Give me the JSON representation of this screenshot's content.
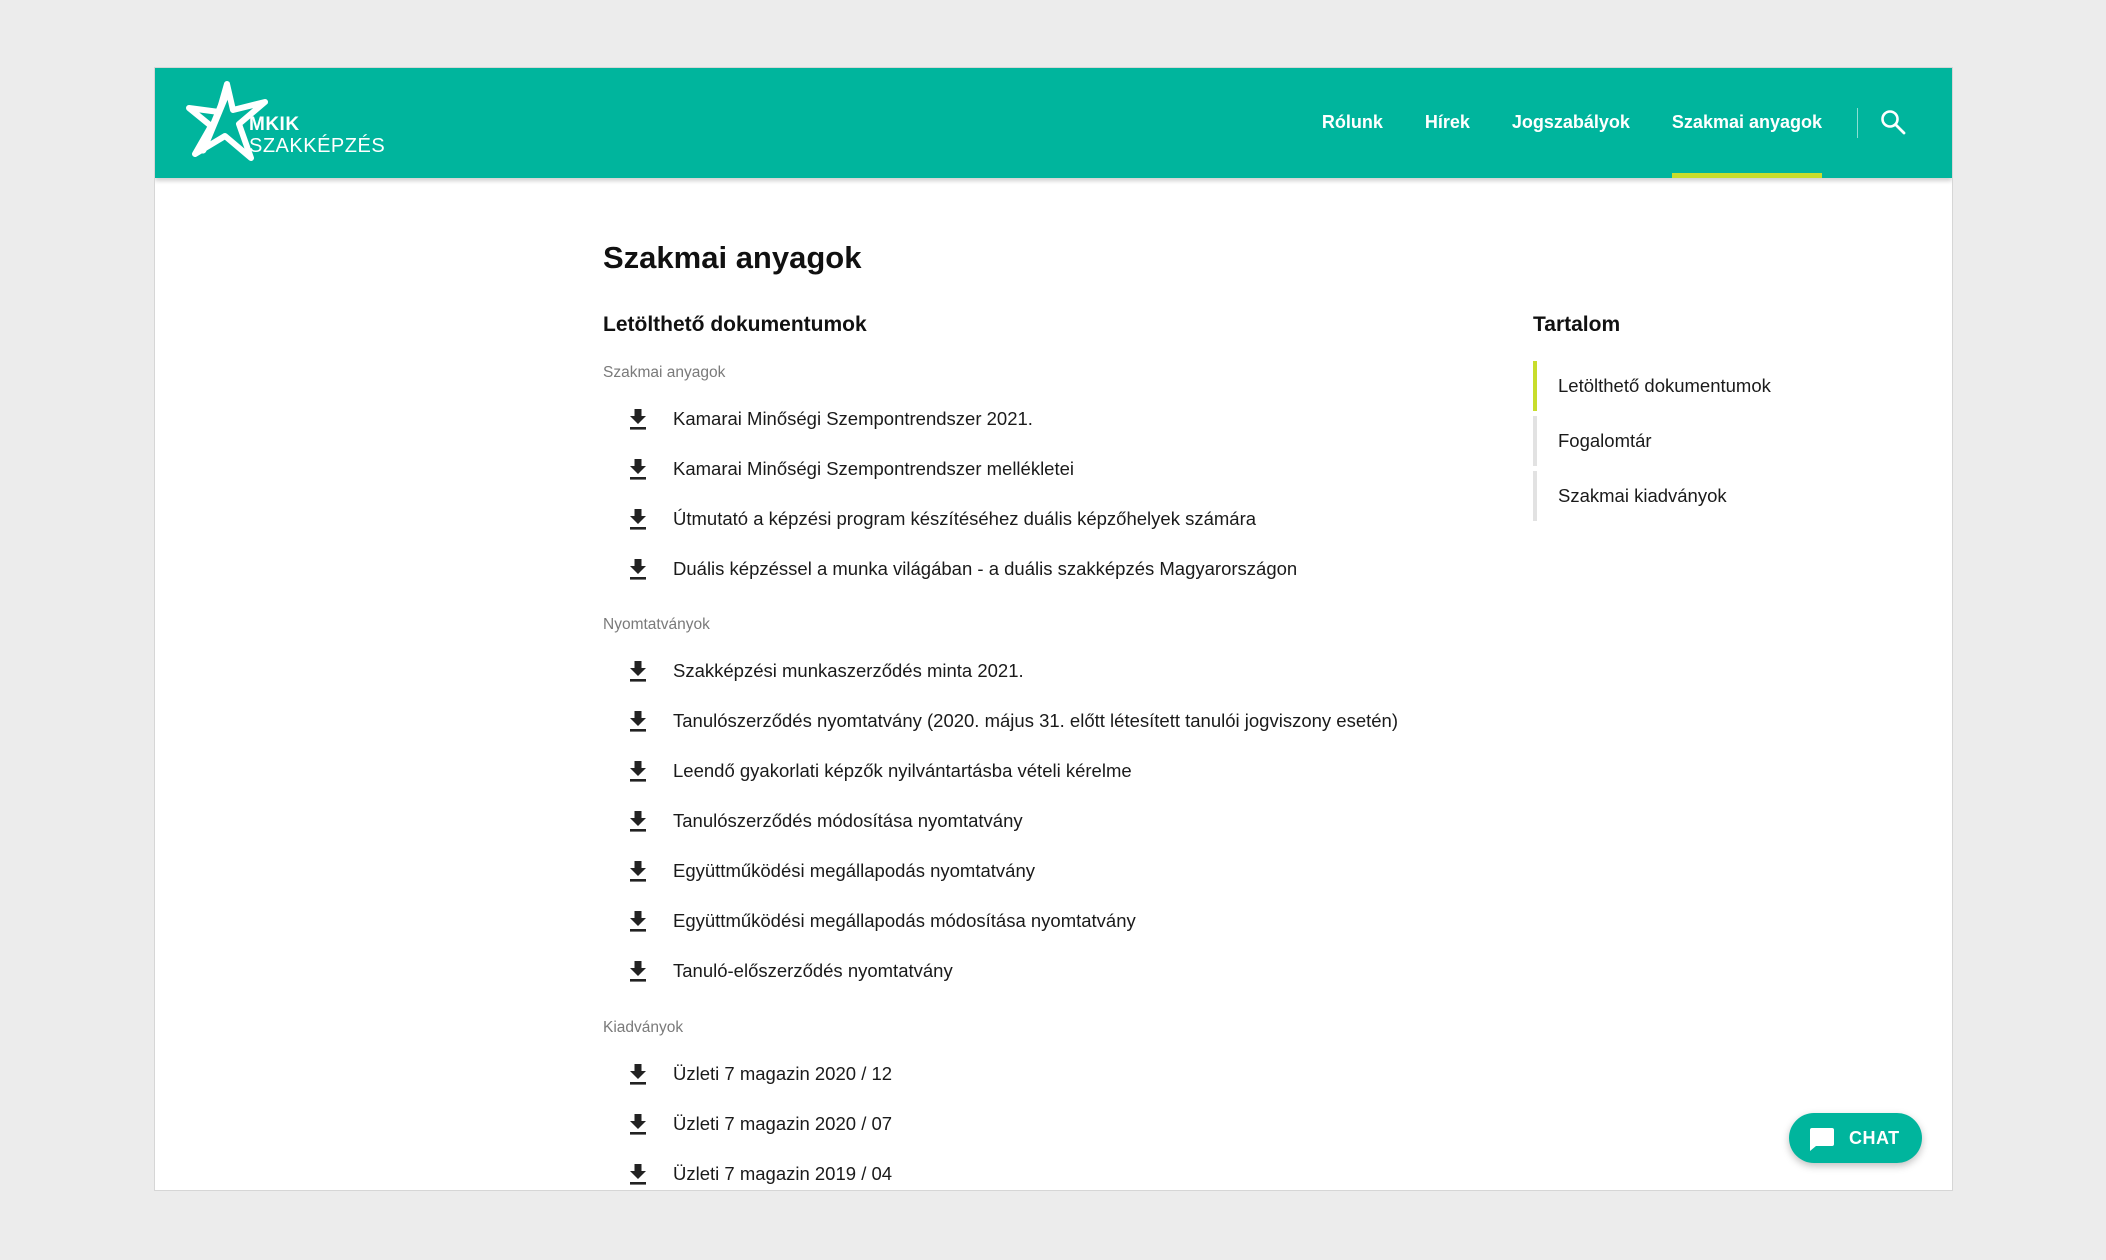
{
  "brand": {
    "top": "MKIK",
    "bottom": "SZAKKÉPZÉS",
    "color": "#00b59d",
    "accent": "#c8dd2c"
  },
  "nav": {
    "items": [
      {
        "label": "Rólunk"
      },
      {
        "label": "Hírek"
      },
      {
        "label": "Jogszabályok"
      },
      {
        "label": "Szakmai anyagok",
        "active": true
      }
    ],
    "search_icon": "search-icon"
  },
  "page": {
    "title": "Szakmai anyagok",
    "section_title": "Letölthető dokumentumok"
  },
  "groups": [
    {
      "label": "Szakmai anyagok",
      "items": [
        "Kamarai Minőségi Szempontrendszer 2021.",
        "Kamarai Minőségi Szempontrendszer mellékletei",
        "Útmutató a képzési program készítéséhez duális képzőhelyek számára",
        "Duális képzéssel a munka világában - a duális szakképzés Magyarországon"
      ]
    },
    {
      "label": "Nyomtatványok",
      "items": [
        "Szakképzési munkaszerződés minta 2021.",
        "Tanulószerződés nyomtatvány (2020. május 31. előtt létesített tanulói jogviszony esetén)",
        "Leendő gyakorlati képzők nyilvántartásba vételi kérelme",
        "Tanulószerződés módosítása nyomtatvány",
        "Együttműködési megállapodás nyomtatvány",
        "Együttműködési megállapodás módosítása nyomtatvány",
        "Tanuló-előszerződés nyomtatvány"
      ]
    },
    {
      "label": "Kiadványok",
      "items": [
        "Üzleti 7 magazin 2020 / 12",
        "Üzleti 7 magazin 2020 / 07",
        "Üzleti 7 magazin 2019 / 04"
      ]
    }
  ],
  "toc": {
    "title": "Tartalom",
    "items": [
      {
        "label": "Letölthető dokumentumok",
        "active": true
      },
      {
        "label": "Fogalomtár"
      },
      {
        "label": "Szakmai kiadványok"
      }
    ]
  },
  "chat": {
    "label": "CHAT",
    "icon": "chat-bubble-icon"
  }
}
